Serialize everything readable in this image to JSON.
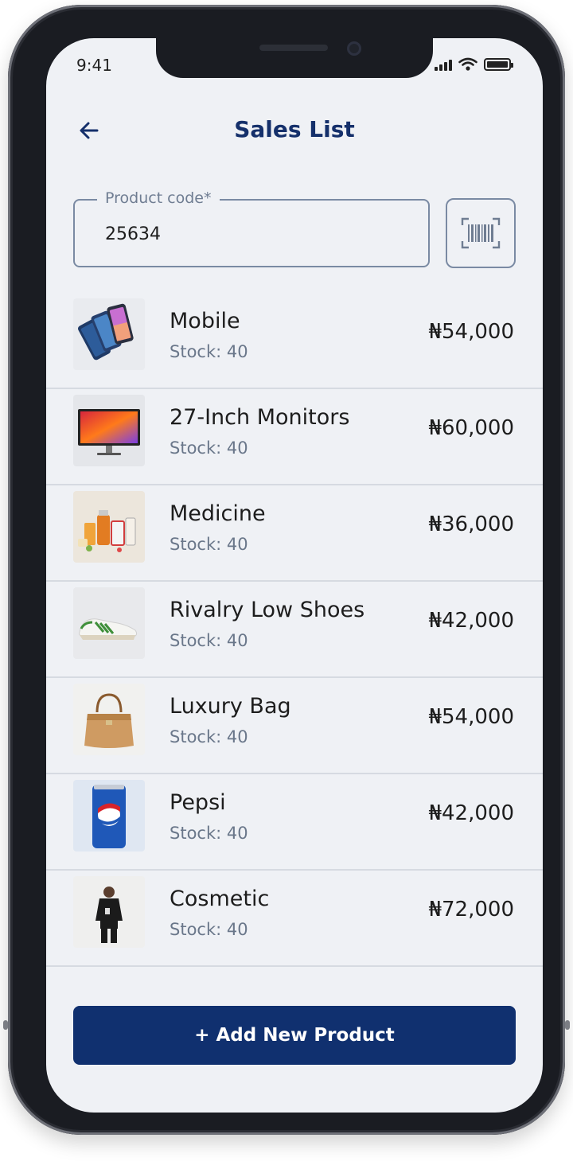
{
  "status_bar": {
    "time": "9:41"
  },
  "header": {
    "title": "Sales List",
    "back_icon": "arrow-left-icon"
  },
  "search": {
    "label": "Product code*",
    "value": "25634",
    "scan_icon": "barcode-scan-icon"
  },
  "products": [
    {
      "name": "Mobile",
      "stock": "Stock: 40",
      "price": "₦54,000",
      "image": "mobile-phones-image"
    },
    {
      "name": "27-Inch Monitors",
      "stock": "Stock: 40",
      "price": "₦60,000",
      "image": "monitor-image"
    },
    {
      "name": "Medicine",
      "stock": "Stock: 40",
      "price": "₦36,000",
      "image": "medicine-image"
    },
    {
      "name": "Rivalry Low Shoes",
      "stock": "Stock: 40",
      "price": "₦42,000",
      "image": "shoes-image"
    },
    {
      "name": "Luxury Bag",
      "stock": "Stock: 40",
      "price": "₦54,000",
      "image": "bag-image"
    },
    {
      "name": "Pepsi",
      "stock": "Stock: 40",
      "price": "₦42,000",
      "image": "pepsi-can-image"
    },
    {
      "name": "Cosmetic",
      "stock": "Stock: 40",
      "price": "₦72,000",
      "image": "cosmetic-image"
    }
  ],
  "add_button": {
    "label": "+ Add New Product"
  },
  "colors": {
    "primary": "#10306f",
    "title": "#15306b",
    "background": "#eff1f5",
    "muted": "#6a778a",
    "border": "#7a8aa3"
  }
}
